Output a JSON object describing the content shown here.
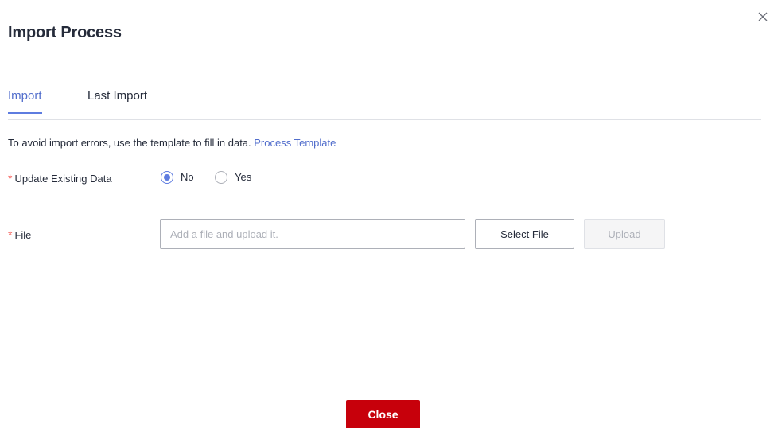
{
  "dialog": {
    "title": "Import Process"
  },
  "tabs": [
    {
      "label": "Import",
      "active": true
    },
    {
      "label": "Last Import",
      "active": false
    }
  ],
  "notice": {
    "text": "To avoid import errors, use the template to fill in data. ",
    "link": "Process Template"
  },
  "form": {
    "required_mark": "*",
    "update_label": "Update Existing Data",
    "options": [
      {
        "label": "No",
        "checked": true
      },
      {
        "label": "Yes",
        "checked": false
      }
    ],
    "file_label": "File",
    "file_placeholder": "Add a file and upload it.",
    "file_value": ""
  },
  "buttons": {
    "select_file": "Select File",
    "upload": "Upload",
    "close": "Close"
  },
  "colors": {
    "accent": "#5e7ce0",
    "link": "#526ecc",
    "required": "#f66f6a",
    "primary_button": "#c7000b"
  },
  "icons": {
    "close": "close-icon"
  }
}
